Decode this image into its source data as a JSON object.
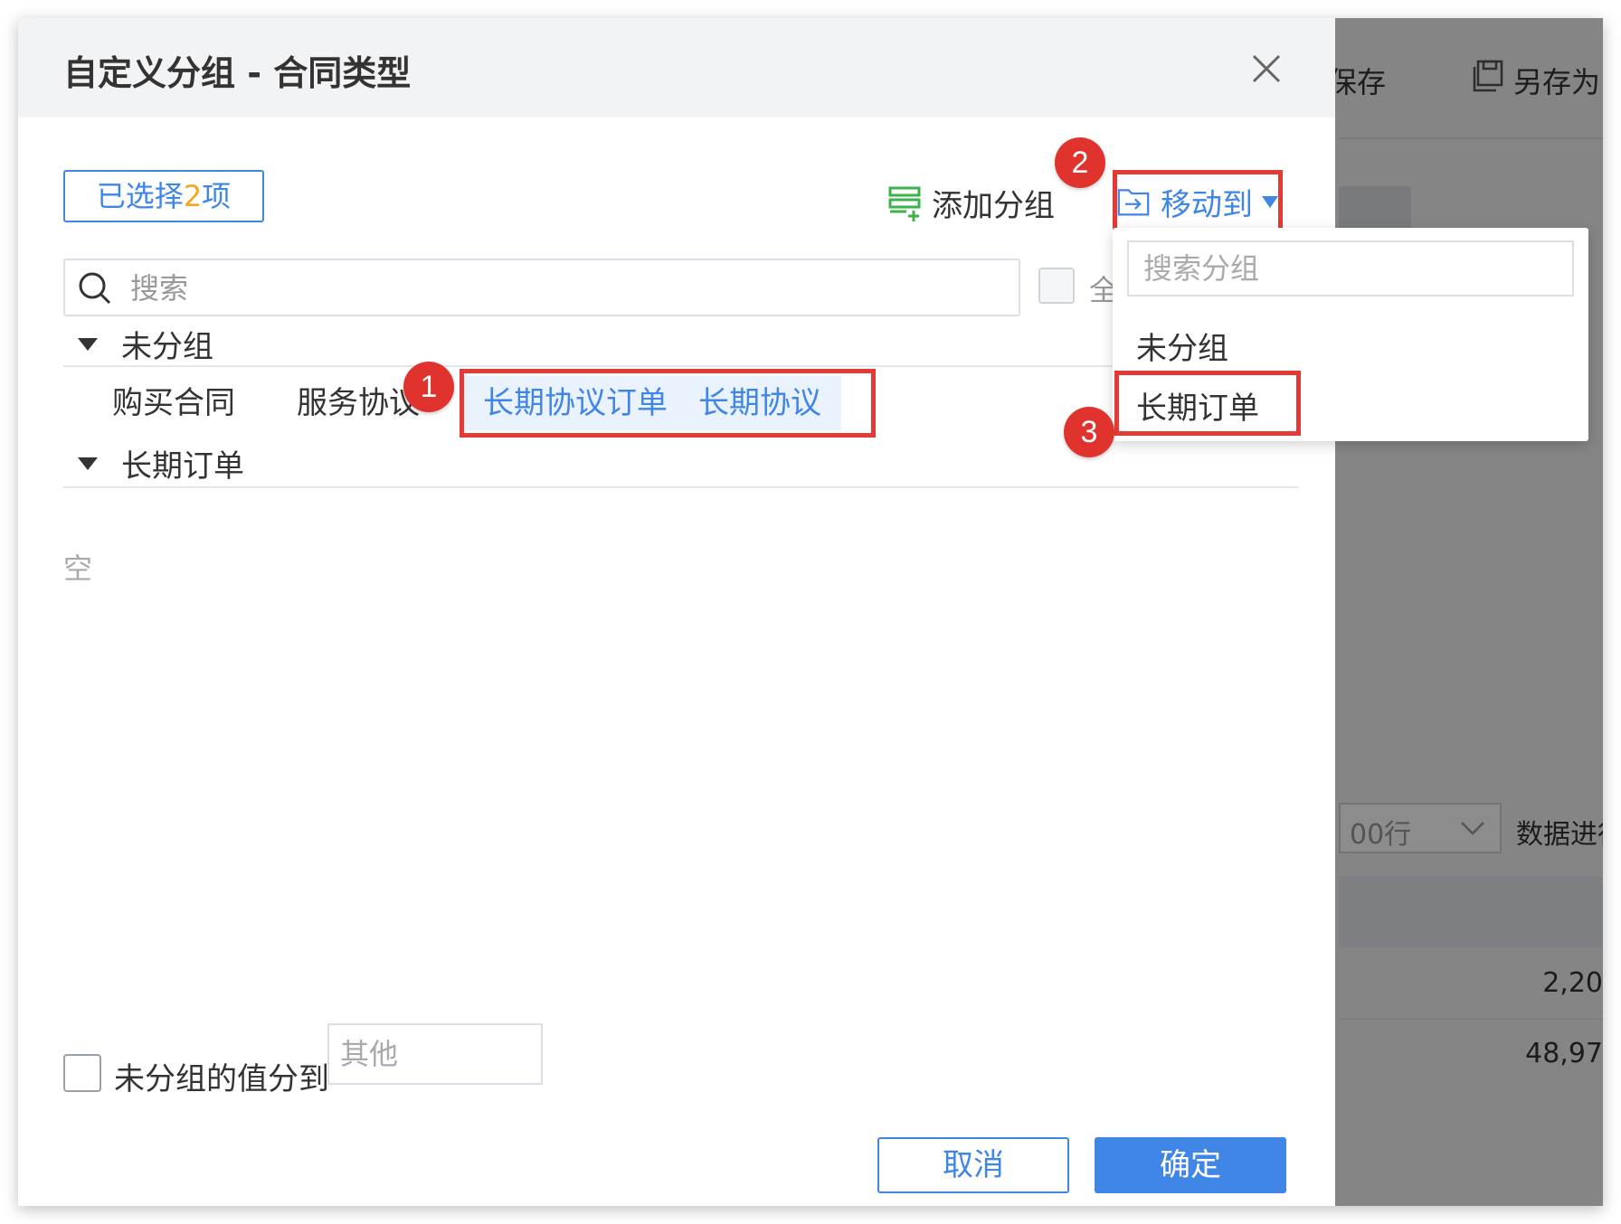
{
  "background": {
    "save_label": "保存",
    "save_as_label": "另存为",
    "rows_select_value": "00行",
    "data_label": "数据进行",
    "cells": [
      "2,20",
      "48,97"
    ]
  },
  "dialog": {
    "title": "自定义分组 - 合同类型",
    "selected_prefix": "已选择",
    "selected_count": "2",
    "selected_suffix": "项",
    "add_group_label": "添加分组",
    "move_to_label": "移动到",
    "search_placeholder": "搜索",
    "select_all_label": "全",
    "groups": [
      {
        "name": "未分组",
        "items": [
          {
            "label": "购买合同",
            "selected": false
          },
          {
            "label": "服务协议",
            "selected": false
          },
          {
            "label": "长期协议订单",
            "selected": true
          },
          {
            "label": "长期协议",
            "selected": true
          }
        ]
      },
      {
        "name": "长期订单",
        "empty_text": "空"
      }
    ],
    "ungrouped_label": "未分组的值分到",
    "ungrouped_placeholder": "其他",
    "cancel_label": "取消",
    "ok_label": "确定"
  },
  "move_dropdown": {
    "search_placeholder": "搜索分组",
    "options": [
      "未分组",
      "长期订单"
    ]
  },
  "annotations": [
    "1",
    "2",
    "3"
  ],
  "colors": {
    "accent": "#3f86e6",
    "highlight": "#e33a35",
    "count": "#f5a623",
    "add_icon": "#3bb34a"
  }
}
